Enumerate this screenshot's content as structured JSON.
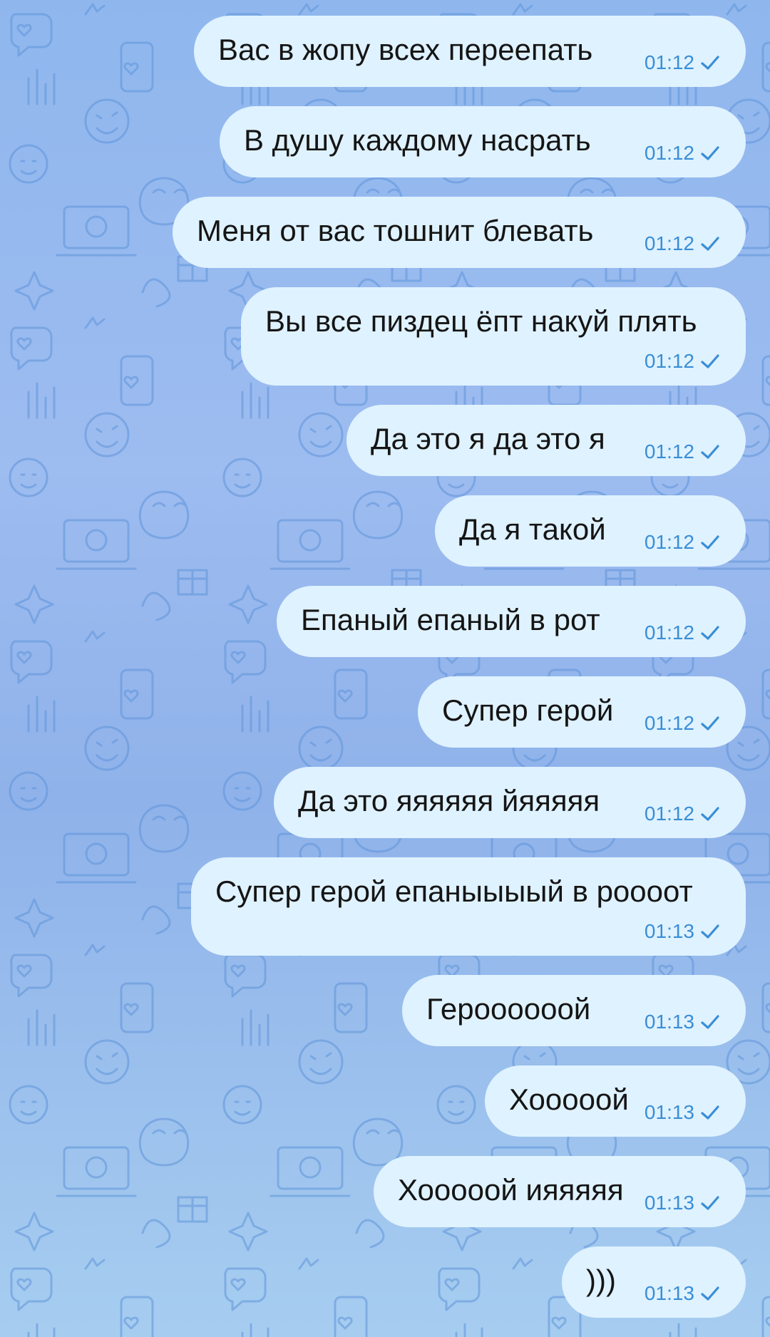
{
  "colors": {
    "bubble": "#dff2ff",
    "text": "#151515",
    "time": "#3a8ed6",
    "background": "#97b9ee"
  },
  "messages": [
    {
      "text": "Вас в жопу всех переепать",
      "time": "01:12",
      "status": "sent"
    },
    {
      "text": "В душу каждому насрать",
      "time": "01:12",
      "status": "sent"
    },
    {
      "text": "Меня от вас тошнит блевать",
      "time": "01:12",
      "status": "sent"
    },
    {
      "text": "Вы все пиздец ёпт накуй плять",
      "time": "01:12",
      "status": "sent"
    },
    {
      "text": "Да это я да это я",
      "time": "01:12",
      "status": "sent"
    },
    {
      "text": "Да я такой",
      "time": "01:12",
      "status": "sent"
    },
    {
      "text": "Епаный епаный в рот",
      "time": "01:12",
      "status": "sent"
    },
    {
      "text": "Супер герой",
      "time": "01:12",
      "status": "sent"
    },
    {
      "text": "Да это яяяяяя йяяяяя",
      "time": "01:12",
      "status": "sent"
    },
    {
      "text": "Супер герой епаныыыый в роооот",
      "time": "01:13",
      "status": "sent"
    },
    {
      "text": "Героооооой",
      "time": "01:13",
      "status": "sent"
    },
    {
      "text": "Хооооой",
      "time": "01:13",
      "status": "sent"
    },
    {
      "text": "Хооооой ияяяяя",
      "time": "01:13",
      "status": "sent"
    },
    {
      "text": ")))",
      "time": "01:13",
      "status": "sent"
    }
  ]
}
